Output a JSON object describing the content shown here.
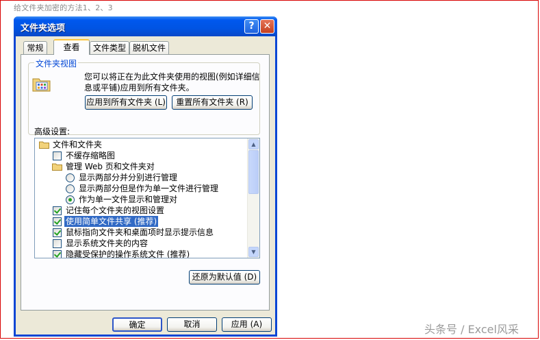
{
  "page": {
    "caption": "给文件夹加密的方法1、2、3",
    "watermark": "头条号 / Excel风采"
  },
  "window": {
    "title": "文件夹选项",
    "help_glyph": "?",
    "close_glyph": "✕",
    "title_bar_color": "#0054e3"
  },
  "tabs": [
    {
      "label": "常规",
      "active": false
    },
    {
      "label": "查看",
      "active": true
    },
    {
      "label": "文件类型",
      "active": false
    },
    {
      "label": "脱机文件",
      "active": false
    }
  ],
  "folder_views": {
    "group_title": "文件夹视图",
    "description": "您可以将正在为此文件夹使用的视图(例如详细信息或平铺)应用到所有文件夹。",
    "apply_all_label": "应用到所有文件夹 (L)",
    "reset_all_label": "重置所有文件夹 (R)"
  },
  "advanced": {
    "label": "高级设置:",
    "items": [
      {
        "type": "folder",
        "level": 0,
        "label": "文件和文件夹"
      },
      {
        "type": "checkbox",
        "level": 1,
        "label": "不缓存缩略图",
        "checked": false
      },
      {
        "type": "folder",
        "level": 1,
        "label": "管理 Web 页和文件夹对"
      },
      {
        "type": "radio",
        "level": 2,
        "label": "显示两部分并分别进行管理",
        "checked": false
      },
      {
        "type": "radio",
        "level": 2,
        "label": "显示两部分但是作为单一文件进行管理",
        "checked": false
      },
      {
        "type": "radio",
        "level": 2,
        "label": "作为单一文件显示和管理对",
        "checked": true
      },
      {
        "type": "checkbox",
        "level": 1,
        "label": "记住每个文件夹的视图设置",
        "checked": true
      },
      {
        "type": "checkbox",
        "level": 1,
        "label": "使用简单文件共享 (推荐)",
        "checked": true,
        "selected": true
      },
      {
        "type": "checkbox",
        "level": 1,
        "label": "鼠标指向文件夹和桌面项时显示提示信息",
        "checked": true
      },
      {
        "type": "checkbox",
        "level": 1,
        "label": "显示系统文件夹的内容",
        "checked": false
      },
      {
        "type": "checkbox",
        "level": 1,
        "label": "隐藏受保护的操作系统文件 (推荐)",
        "checked": true
      }
    ],
    "restore_defaults_label": "还原为默认值 (D)"
  },
  "footer": {
    "ok_label": "确定",
    "cancel_label": "取消",
    "apply_label": "应用 (A)"
  },
  "colors": {
    "selection": "#316ac5",
    "check_green": "#21a121",
    "dialog_bg": "#ece9d8"
  }
}
